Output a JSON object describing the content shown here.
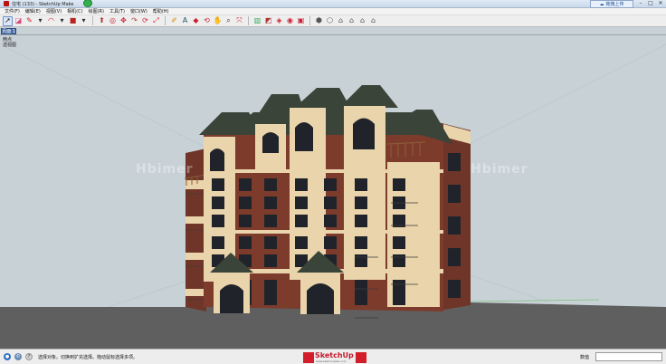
{
  "window": {
    "title": "住宅 (133) - SketchUp Make",
    "upload_label": "拖拽上传",
    "minimize": "–",
    "maximize": "□",
    "close": "✕"
  },
  "menu": [
    "文件(F)",
    "编辑(E)",
    "视图(V)",
    "相机(C)",
    "绘图(R)",
    "工具(T)",
    "窗口(W)",
    "帮助(H)"
  ],
  "toolbar": {
    "group1": [
      {
        "name": "select-icon",
        "glyph": "➚",
        "color": "#222",
        "selected": true
      },
      {
        "name": "eraser-icon",
        "glyph": "◪",
        "color": "#d24a7a",
        "selected": false
      },
      {
        "name": "line-icon",
        "glyph": "✎",
        "color": "#c23",
        "selected": false
      },
      {
        "name": "line-dropdown-icon",
        "glyph": "▾",
        "color": "#333",
        "selected": false
      },
      {
        "name": "arc-icon",
        "glyph": "◠",
        "color": "#c23",
        "selected": false
      },
      {
        "name": "arc-dropdown-icon",
        "glyph": "▾",
        "color": "#333",
        "selected": false
      },
      {
        "name": "rectangle-icon",
        "glyph": "■",
        "color": "#b22",
        "selected": false
      },
      {
        "name": "rectangle-dropdown-icon",
        "glyph": "▾",
        "color": "#333",
        "selected": false
      }
    ],
    "group2": [
      {
        "name": "push-pull-icon",
        "glyph": "⬆",
        "color": "#a33",
        "selected": false
      },
      {
        "name": "offset-icon",
        "glyph": "◎",
        "color": "#c23",
        "selected": false
      },
      {
        "name": "move-icon",
        "glyph": "✥",
        "color": "#c23",
        "selected": false
      },
      {
        "name": "follow-me-icon",
        "glyph": "↷",
        "color": "#b33",
        "selected": false
      },
      {
        "name": "rotate-icon",
        "glyph": "⟳",
        "color": "#c23",
        "selected": false
      },
      {
        "name": "scale-icon",
        "glyph": "⤢",
        "color": "#c23",
        "selected": false
      }
    ],
    "group3": [
      {
        "name": "tape-measure-icon",
        "glyph": "✐",
        "color": "#c80",
        "selected": false
      },
      {
        "name": "text-icon",
        "glyph": "A",
        "color": "#256",
        "selected": false
      },
      {
        "name": "paint-bucket-icon",
        "glyph": "◆",
        "color": "#c23",
        "selected": false
      },
      {
        "name": "orbit-icon",
        "glyph": "⟲",
        "color": "#c23",
        "selected": false
      },
      {
        "name": "pan-icon",
        "glyph": "✋",
        "color": "#c23",
        "selected": false
      },
      {
        "name": "zoom-icon",
        "glyph": "⌕",
        "color": "#333",
        "selected": false
      },
      {
        "name": "zoom-extents-icon",
        "glyph": "⤧",
        "color": "#c23",
        "selected": false
      }
    ],
    "group4": [
      {
        "name": "components-icon",
        "glyph": "▥",
        "color": "#3a5",
        "selected": false
      },
      {
        "name": "3d-warehouse-icon",
        "glyph": "◩",
        "color": "#a33",
        "selected": false
      },
      {
        "name": "extension-warehouse-icon",
        "glyph": "◈",
        "color": "#c23",
        "selected": false
      },
      {
        "name": "sketchup-shop-icon",
        "glyph": "◉",
        "color": "#c23",
        "selected": false
      },
      {
        "name": "layout-icon",
        "glyph": "▣",
        "color": "#c23",
        "selected": false
      }
    ],
    "group5": [
      {
        "name": "iso-view-icon",
        "glyph": "⬢",
        "color": "#555",
        "selected": false
      },
      {
        "name": "top-view-icon",
        "glyph": "⬡",
        "color": "#555",
        "selected": false
      },
      {
        "name": "front-view-icon",
        "glyph": "⌂",
        "color": "#555",
        "selected": false
      },
      {
        "name": "right-view-icon",
        "glyph": "⌂",
        "color": "#555",
        "selected": false
      },
      {
        "name": "back-view-icon",
        "glyph": "⌂",
        "color": "#555",
        "selected": false
      },
      {
        "name": "left-view-icon",
        "glyph": "⌂",
        "color": "#555",
        "selected": false
      }
    ]
  },
  "scene_tab": "页面 1",
  "view_labels": [
    "两点",
    "透视图"
  ],
  "watermark_left": "Hbimer",
  "watermark_right": "Hbimer",
  "status": {
    "hint": "选择对象。切换到扩充选择。拖动鼠标选择多项。",
    "measure_label": "数值",
    "logo_text": "SketchUp",
    "logo_sub": "www.sketchupbar.com"
  },
  "colors": {
    "sky": "#c8d1d6",
    "ground": "#5f5f5f",
    "brick": "#7d3b2c",
    "cream": "#ead4ac",
    "roof": "#3b4438",
    "window": "#20242a",
    "accent": "#4a6ea9"
  }
}
